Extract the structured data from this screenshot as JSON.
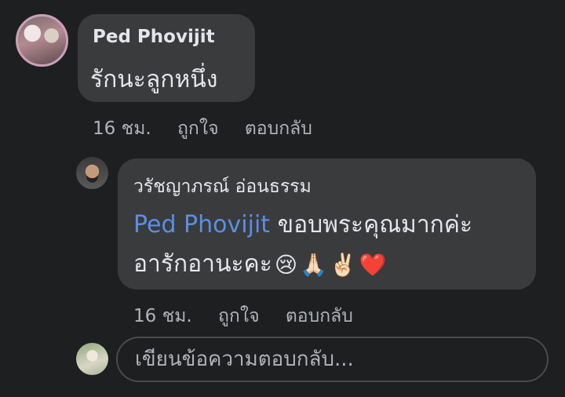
{
  "comments": [
    {
      "author": "Ped Phovijit",
      "text": "รักนะลูกหนึ่ง",
      "time": "16 ชม.",
      "like_label": "ถูกใจ",
      "reply_label": "ตอบกลับ"
    }
  ],
  "replies": [
    {
      "author": "วรัชญาภรณ์ อ่อนธรรม",
      "mention": "Ped Phovijit",
      "text_line1": " ขอบพระคุณมากค่ะ",
      "text_line2": "อารักอานะคะ",
      "emojis": [
        "😢",
        "🙏🏻",
        "✌🏻",
        "❤️"
      ],
      "time": "16 ชม.",
      "like_label": "ถูกใจ",
      "reply_label": "ตอบกลับ"
    }
  ],
  "reply_input": {
    "placeholder": "เขียนข้อความตอบกลับ..."
  }
}
